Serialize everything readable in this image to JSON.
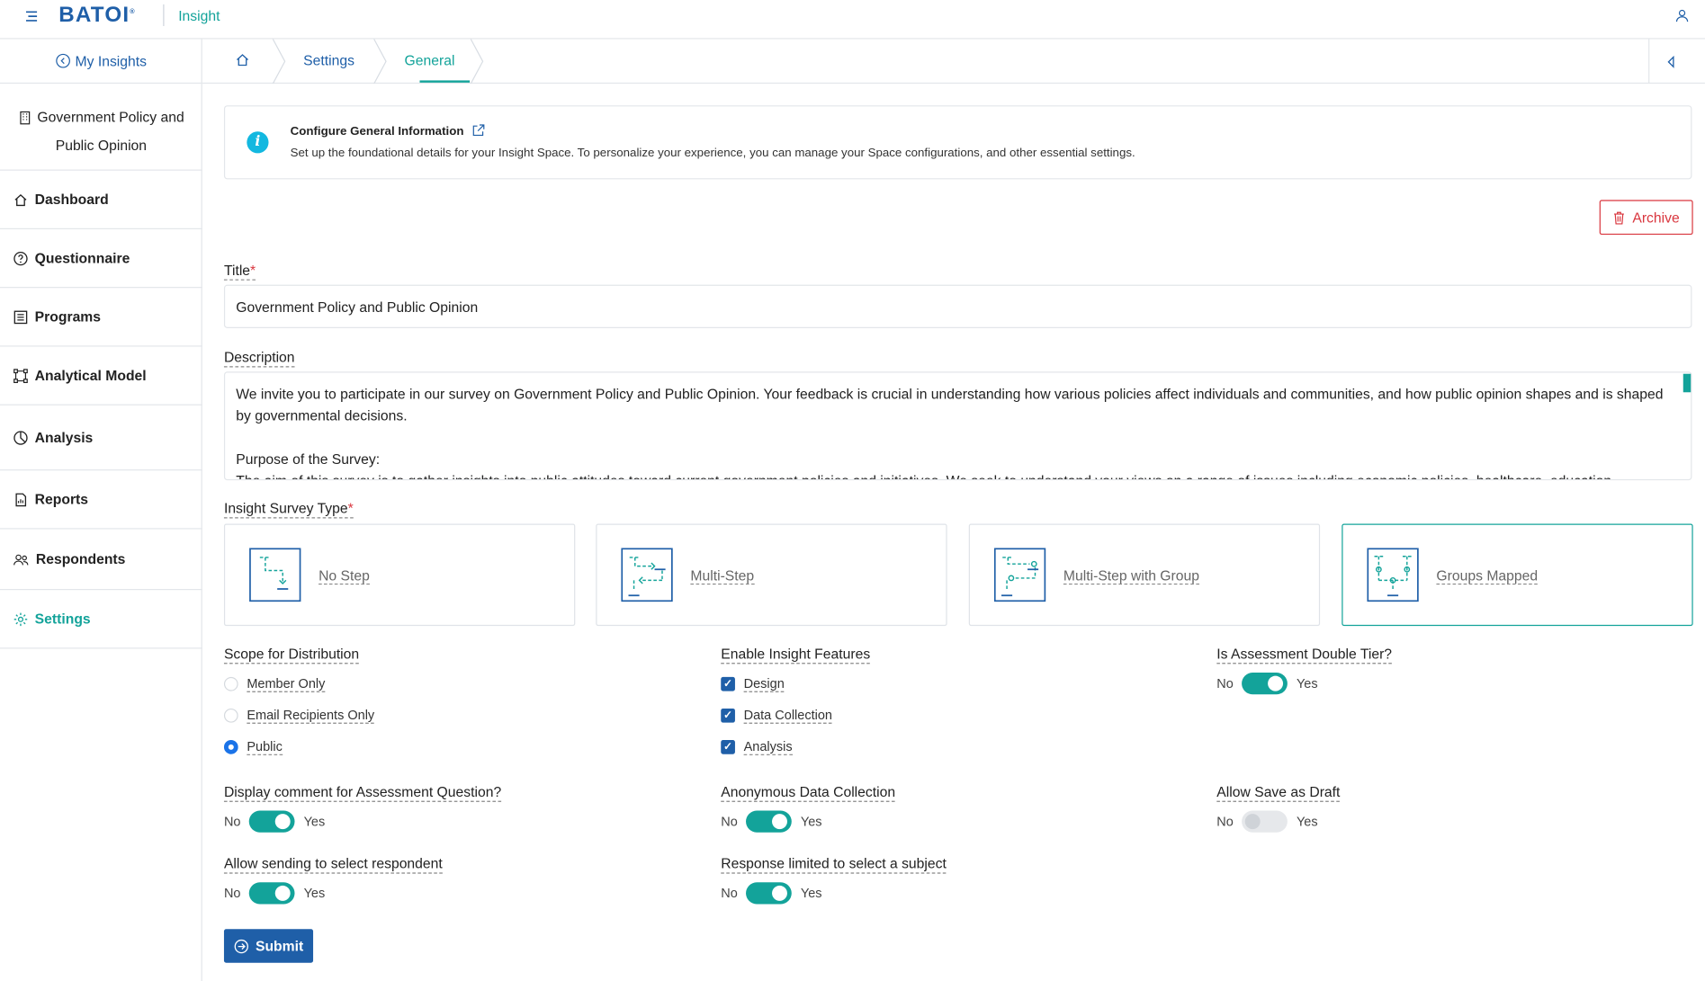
{
  "header": {
    "logo_text": "BATOI",
    "app_name": "Insight"
  },
  "sidebar": {
    "back_label": "My Insights",
    "space_name": "Government Policy and Public Opinion",
    "items": [
      {
        "label": "Dashboard",
        "icon": "home-icon"
      },
      {
        "label": "Questionnaire",
        "icon": "question-icon"
      },
      {
        "label": "Programs",
        "icon": "list-icon"
      },
      {
        "label": "Analytical Model",
        "icon": "model-icon"
      },
      {
        "label": "Analysis",
        "icon": "pie-icon"
      },
      {
        "label": "Reports",
        "icon": "report-icon"
      },
      {
        "label": "Respondents",
        "icon": "users-icon"
      },
      {
        "label": "Settings",
        "icon": "gear-icon",
        "active": true
      }
    ]
  },
  "breadcrumb": {
    "items": [
      "Settings",
      "General"
    ]
  },
  "info": {
    "title": "Configure General Information",
    "description": "Set up the foundational details for your Insight Space. To personalize your experience, you can manage your Space configurations, and other essential settings."
  },
  "archive_label": "Archive",
  "form": {
    "title_label": "Title",
    "title_value": "Government Policy and Public Opinion",
    "description_label": "Description",
    "description_value": "We invite you to participate in our survey on Government Policy and Public Opinion. Your feedback is crucial in understanding how various policies affect individuals and communities, and how public opinion shapes and is shaped by governmental decisions.\n\nPurpose of the Survey:\nThe aim of this survey is to gather insights into public attitudes toward current government policies and initiatives. We seek to understand your views on a range of issues including economic policies, healthcare, education,",
    "survey_type_label": "Insight Survey Type",
    "survey_types": [
      {
        "label": "No Step",
        "selected": false
      },
      {
        "label": "Multi-Step",
        "selected": false
      },
      {
        "label": "Multi-Step with Group",
        "selected": false
      },
      {
        "label": "Groups Mapped",
        "selected": true
      }
    ],
    "scope_label": "Scope for Distribution",
    "scope_options": [
      {
        "label": "Member Only",
        "selected": false
      },
      {
        "label": "Email Recipients Only",
        "selected": false
      },
      {
        "label": "Public",
        "selected": true
      }
    ],
    "features_label": "Enable Insight Features",
    "features": [
      {
        "label": "Design",
        "checked": true
      },
      {
        "label": "Data Collection",
        "checked": true
      },
      {
        "label": "Analysis",
        "checked": true
      }
    ],
    "toggles": [
      {
        "label": "Is Assessment Double Tier?",
        "on": true
      },
      {
        "label": "Display comment for Assessment Question?",
        "on": true
      },
      {
        "label": "Anonymous Data Collection",
        "on": true
      },
      {
        "label": "Allow Save as Draft",
        "on": false
      },
      {
        "label": "Allow sending to select respondent",
        "on": true
      },
      {
        "label": "Response limited to select a subject",
        "on": true
      }
    ],
    "no_label": "No",
    "yes_label": "Yes",
    "submit_label": "Submit"
  },
  "colors": {
    "primary": "#1f5fa8",
    "accent": "#13a39a",
    "danger": "#d9363e",
    "info": "#13b8e0"
  }
}
